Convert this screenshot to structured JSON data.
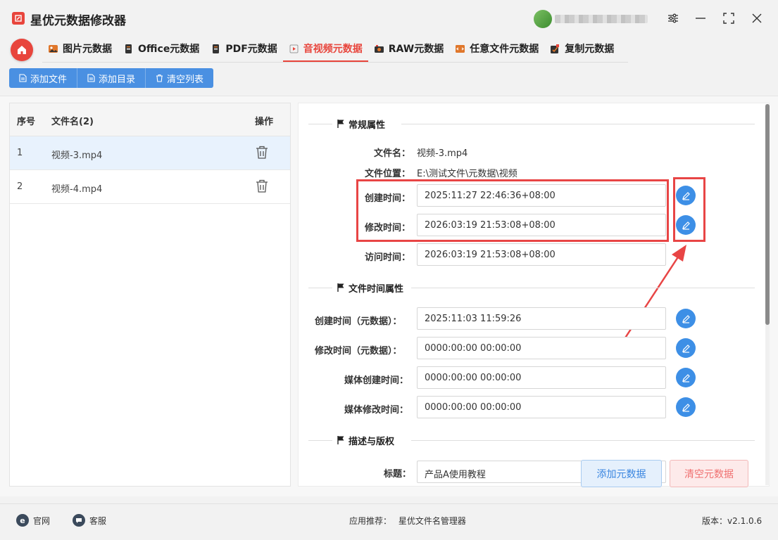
{
  "app": {
    "title": "星优元数据修改器"
  },
  "tabs": [
    {
      "label": "图片元数据",
      "icon": "image-icon"
    },
    {
      "label": "Office元数据",
      "icon": "office-icon"
    },
    {
      "label": "PDF元数据",
      "icon": "pdf-icon"
    },
    {
      "label": "音视频元数据",
      "icon": "media-icon",
      "active": true
    },
    {
      "label": "RAW元数据",
      "icon": "raw-camera-icon"
    },
    {
      "label": "任意文件元数据",
      "icon": "file-icon"
    },
    {
      "label": "复制元数据",
      "icon": "copy-icon"
    }
  ],
  "toolbar": {
    "add_file": "添加文件",
    "add_dir": "添加目录",
    "clear_list": "清空列表"
  },
  "file_list": {
    "col_index": "序号",
    "col_name": "文件名(2)",
    "col_op": "操作",
    "rows": [
      {
        "index": "1",
        "name": "视频-3.mp4",
        "selected": true
      },
      {
        "index": "2",
        "name": "视频-4.mp4",
        "selected": false
      }
    ]
  },
  "general": {
    "title": "常规属性",
    "file_name_label": "文件名：",
    "file_name": "视频-3.mp4",
    "file_path_label": "文件位置：",
    "file_path": "E:\\测试文件\\元数据\\视频",
    "created_label": "创建时间：",
    "created": "2025:11:27 22:46:36+08:00",
    "modified_label": "修改时间：",
    "modified": "2026:03:19 21:53:08+08:00",
    "accessed_label": "访问时间：",
    "accessed": "2026:03:19 21:53:08+08:00"
  },
  "file_time": {
    "title": "文件时间属性",
    "meta_created_label": "创建时间（元数据）：",
    "meta_created": "2025:11:03 11:59:26",
    "meta_modified_label": "修改时间（元数据）：",
    "meta_modified": "0000:00:00 00:00:00",
    "media_created_label": "媒体创建时间：",
    "media_created": "0000:00:00 00:00:00",
    "media_modified_label": "媒体修改时间：",
    "media_modified": "0000:00:00 00:00:00"
  },
  "desc": {
    "title": "描述与版权",
    "title_label": "标题：",
    "title_value": "产品A使用教程"
  },
  "actions": {
    "add_meta": "添加元数据",
    "clear_meta": "清空元数据"
  },
  "footer": {
    "website": "官网",
    "service": "客服",
    "recommend_label": "应用推荐：",
    "recommend_app": "星优文件名管理器",
    "version_label": "版本：",
    "version": "v2.1.0.6"
  },
  "colors": {
    "accent": "#e8453c",
    "primary": "#4a90e2",
    "edit": "#3d8fe6",
    "highlight": "#e84545"
  }
}
